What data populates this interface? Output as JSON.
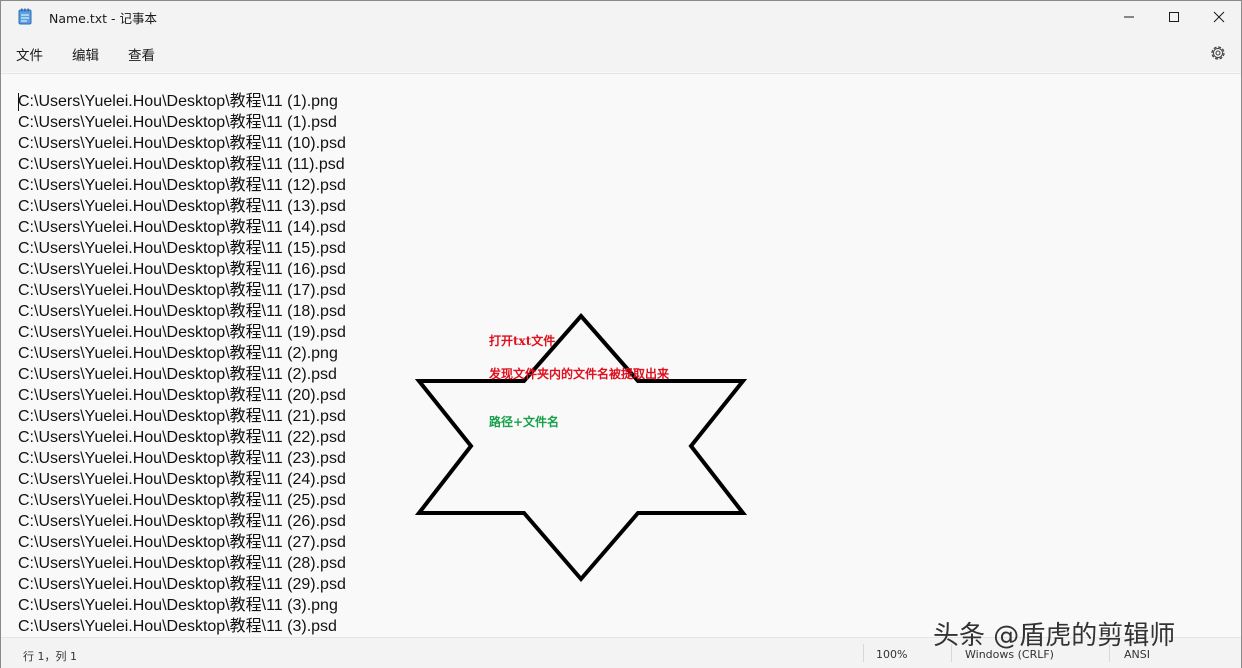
{
  "window": {
    "title": "Name.txt - 记事本"
  },
  "menu": {
    "file": "文件",
    "edit": "编辑",
    "view": "查看"
  },
  "lines": [
    "C:\\Users\\Yuelei.Hou\\Desktop\\教程\\11 (1).png",
    "C:\\Users\\Yuelei.Hou\\Desktop\\教程\\11 (1).psd",
    "C:\\Users\\Yuelei.Hou\\Desktop\\教程\\11 (10).psd",
    "C:\\Users\\Yuelei.Hou\\Desktop\\教程\\11 (11).psd",
    "C:\\Users\\Yuelei.Hou\\Desktop\\教程\\11 (12).psd",
    "C:\\Users\\Yuelei.Hou\\Desktop\\教程\\11 (13).psd",
    "C:\\Users\\Yuelei.Hou\\Desktop\\教程\\11 (14).psd",
    "C:\\Users\\Yuelei.Hou\\Desktop\\教程\\11 (15).psd",
    "C:\\Users\\Yuelei.Hou\\Desktop\\教程\\11 (16).psd",
    "C:\\Users\\Yuelei.Hou\\Desktop\\教程\\11 (17).psd",
    "C:\\Users\\Yuelei.Hou\\Desktop\\教程\\11 (18).psd",
    "C:\\Users\\Yuelei.Hou\\Desktop\\教程\\11 (19).psd",
    "C:\\Users\\Yuelei.Hou\\Desktop\\教程\\11 (2).png",
    "C:\\Users\\Yuelei.Hou\\Desktop\\教程\\11 (2).psd",
    "C:\\Users\\Yuelei.Hou\\Desktop\\教程\\11 (20).psd",
    "C:\\Users\\Yuelei.Hou\\Desktop\\教程\\11 (21).psd",
    "C:\\Users\\Yuelei.Hou\\Desktop\\教程\\11 (22).psd",
    "C:\\Users\\Yuelei.Hou\\Desktop\\教程\\11 (23).psd",
    "C:\\Users\\Yuelei.Hou\\Desktop\\教程\\11 (24).psd",
    "C:\\Users\\Yuelei.Hou\\Desktop\\教程\\11 (25).psd",
    "C:\\Users\\Yuelei.Hou\\Desktop\\教程\\11 (26).psd",
    "C:\\Users\\Yuelei.Hou\\Desktop\\教程\\11 (27).psd",
    "C:\\Users\\Yuelei.Hou\\Desktop\\教程\\11 (28).psd",
    "C:\\Users\\Yuelei.Hou\\Desktop\\教程\\11 (29).psd",
    "C:\\Users\\Yuelei.Hou\\Desktop\\教程\\11 (3).png",
    "C:\\Users\\Yuelei.Hou\\Desktop\\教程\\11 (3).psd"
  ],
  "annotation": {
    "line1": "打开txt文件",
    "line2": "发现文件夹内的文件名被提取出来",
    "line3": "路径+文件名",
    "red": "#e0101e",
    "green": "#18a04a"
  },
  "status": {
    "position": "行 1，列 1",
    "zoom": "100%",
    "line_ending": "Windows (CRLF)",
    "encoding": "ANSI"
  },
  "watermark": "头条 @盾虎的剪辑师",
  "icons": {
    "app": "notepad-icon",
    "settings": "gear-icon",
    "minimize": "minimize-icon",
    "maximize": "maximize-icon",
    "close": "close-icon"
  }
}
